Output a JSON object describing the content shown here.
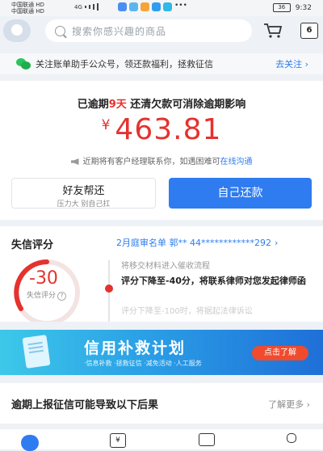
{
  "status_bar": {
    "carrier1": "中国联通 HD",
    "carrier2": "中国联通 HD",
    "network": "4G",
    "battery": "36",
    "time": "9:32"
  },
  "header": {
    "search_placeholder": "搜索你感兴趣的商品",
    "calendar_day": "6"
  },
  "notice": {
    "text": "关注账单助手公众号，领还款福利，拯救征信",
    "link": "去关注 ›"
  },
  "overdue": {
    "headline_pre": "已逾期",
    "headline_days": "9天",
    "headline_post": " 还清欠款可消除逾期影响",
    "currency": "¥",
    "amount": "463.81",
    "hint_text": "近期将有客户经理联系你，如遇困难可",
    "hint_link": "在线沟通",
    "friend_button": "好友帮还",
    "friend_sub": "压力大 别自己扛",
    "self_button": "自己还款"
  },
  "credit": {
    "title": "失信评分",
    "case_text": "2月庭审名单 郭** 44************292",
    "case_chevron": "›",
    "score": "-30",
    "score_label": "失信评分",
    "help_mark": "?",
    "timeline_1": "将移交材料进入催收流程",
    "timeline_2": "评分下降至-40分，将联系律师对您发起律师函",
    "timeline_3": "评分下降至-100时，将据起法律诉讼"
  },
  "banner": {
    "title": "信用补救计划",
    "subtitle": "·信息补救 ·拯救征信 ·减免活动 ·人工服务",
    "button": "点击了解"
  },
  "bottom": {
    "title": "逾期上报征信可能导致以下后果",
    "more": "了解更多 ›"
  },
  "tabbar": {
    "bill_glyph": "¥"
  },
  "colors": {
    "accent_blue": "#2f7cf0",
    "alert_red": "#e5322e"
  }
}
